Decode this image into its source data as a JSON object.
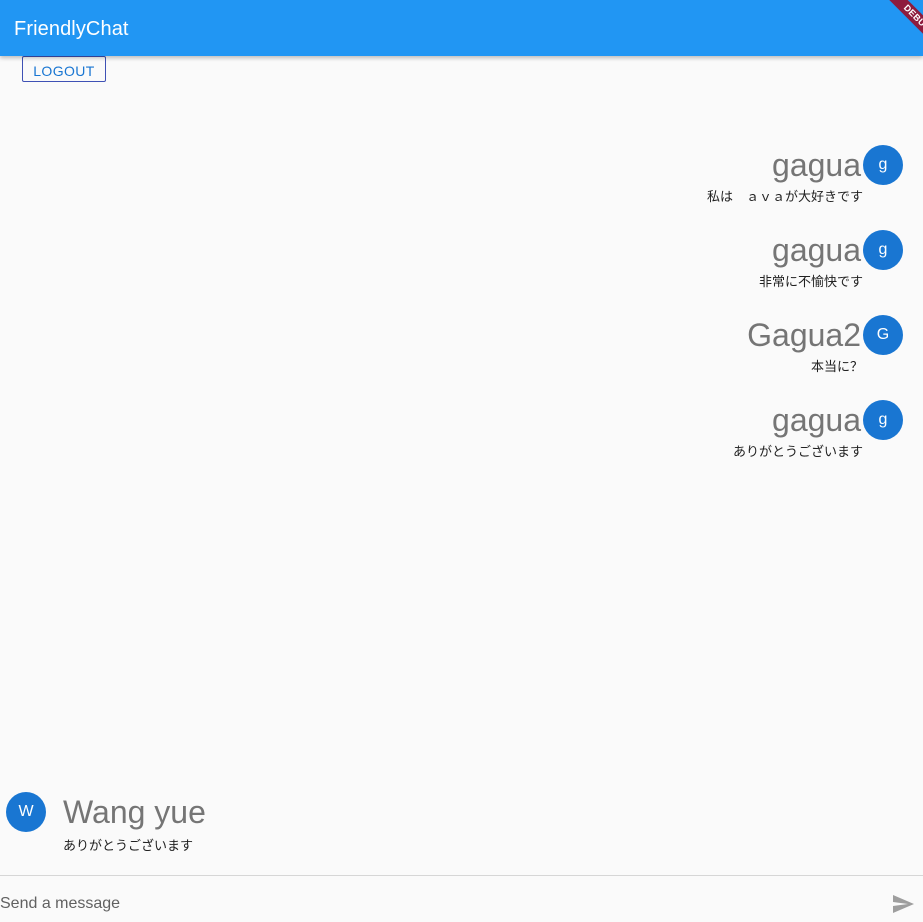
{
  "app": {
    "title": "FriendlyChat",
    "debug_banner": "DEBUG"
  },
  "toolbar": {
    "logout_label": "LOGOUT"
  },
  "messages": [
    {
      "initial": "g",
      "name": "gagua",
      "text": "私は　ａｖａが大好きです"
    },
    {
      "initial": "g",
      "name": "gagua",
      "text": "非常に不愉快です"
    },
    {
      "initial": "G",
      "name": "Gagua2",
      "text": "本当に？"
    },
    {
      "initial": "g",
      "name": "gagua",
      "text": "ありがとうございます"
    }
  ],
  "incoming": {
    "initial": "W",
    "name": "Wang yue",
    "text": "ありがとうございます"
  },
  "composer": {
    "placeholder": "Send a message",
    "send_icon": "send-icon"
  },
  "colors": {
    "appbar": "#2196f3",
    "avatar": "#1976d2",
    "debug_ribbon": "#8e1c3e",
    "logout_border": "#3f51b5"
  }
}
